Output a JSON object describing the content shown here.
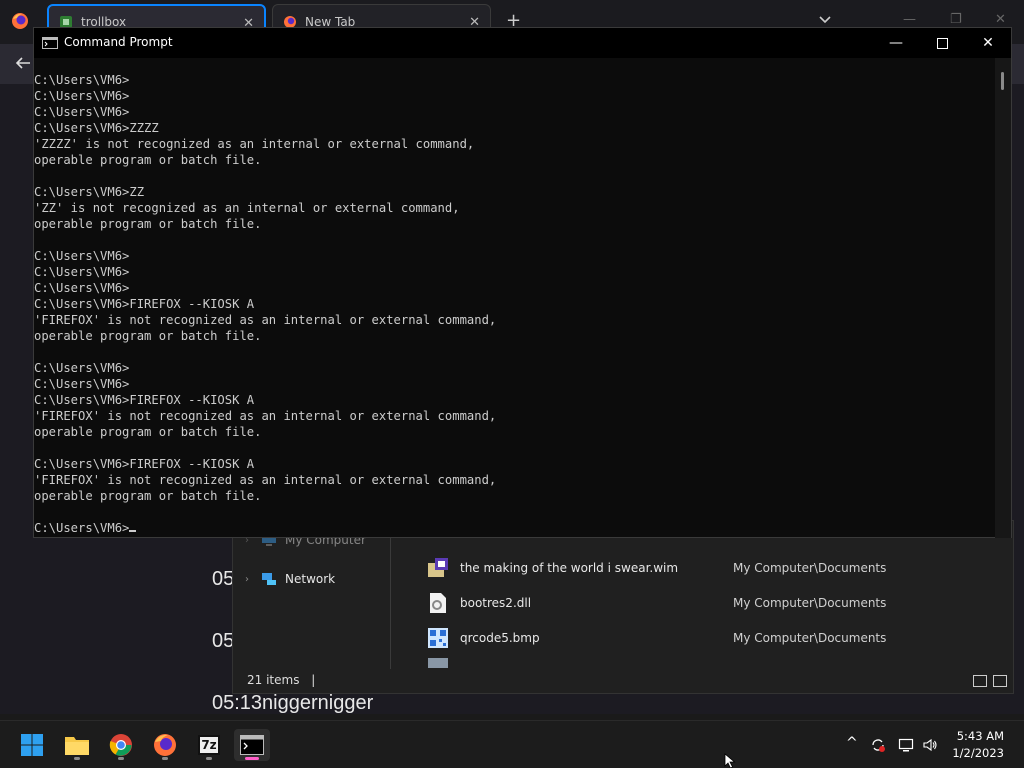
{
  "browser": {
    "tabs": [
      {
        "label": "trollbox",
        "active": true
      },
      {
        "label": "New Tab",
        "active": false
      }
    ],
    "newtab_symbol": "+",
    "content_lines": [
      {
        "text": "05"
      },
      {
        "text": "05"
      },
      {
        "text": "05:13niggernigger"
      }
    ]
  },
  "explorer": {
    "nav": [
      {
        "label": "My Computer"
      },
      {
        "label": "Network"
      }
    ],
    "files": [
      {
        "name": "the making of the world i swear.wim",
        "location": "My Computer\\Documents",
        "icon": "wim-file-icon"
      },
      {
        "name": "bootres2.dll",
        "location": "My Computer\\Documents",
        "icon": "dll-file-icon"
      },
      {
        "name": "qrcode5.bmp",
        "location": "My Computer\\Documents",
        "icon": "qr-image-icon"
      }
    ],
    "status": "21 items",
    "status_sep": "|"
  },
  "cmd": {
    "title": "Command Prompt",
    "lines": [
      "C:\\Users\\VM6>",
      "C:\\Users\\VM6>",
      "C:\\Users\\VM6>",
      "C:\\Users\\VM6>ZZZZ",
      "'ZZZZ' is not recognized as an internal or external command,",
      "operable program or batch file.",
      "",
      "C:\\Users\\VM6>ZZ",
      "'ZZ' is not recognized as an internal or external command,",
      "operable program or batch file.",
      "",
      "C:\\Users\\VM6>",
      "C:\\Users\\VM6>",
      "C:\\Users\\VM6>",
      "C:\\Users\\VM6>FIREFOX --KIOSK A",
      "'FIREFOX' is not recognized as an internal or external command,",
      "operable program or batch file.",
      "",
      "C:\\Users\\VM6>",
      "C:\\Users\\VM6>",
      "C:\\Users\\VM6>FIREFOX --KIOSK A",
      "'FIREFOX' is not recognized as an internal or external command,",
      "operable program or batch file.",
      "",
      "C:\\Users\\VM6>FIREFOX --KIOSK A",
      "'FIREFOX' is not recognized as an internal or external command,",
      "operable program or batch file.",
      ""
    ],
    "prompt": "C:\\Users\\VM6>",
    "minimize_symbol": "—",
    "close_symbol": "✕"
  },
  "taskbar": {
    "apps": [
      {
        "name": "start-button",
        "icon": "windows-logo-icon"
      },
      {
        "name": "file-explorer",
        "icon": "folder-icon"
      },
      {
        "name": "chrome",
        "icon": "chrome-icon"
      },
      {
        "name": "firefox",
        "icon": "firefox-icon"
      },
      {
        "name": "7zip",
        "icon": "7zip-icon",
        "label": "7z"
      },
      {
        "name": "command-prompt",
        "icon": "cmd-icon"
      }
    ],
    "tray_chevron": "^",
    "time": "5:43 AM",
    "date": "1/2/2023"
  },
  "colors": {
    "accent_tab": "#0a84ff",
    "cmd_text": "#cccccc",
    "active_indicator": "#ff5fc9"
  }
}
